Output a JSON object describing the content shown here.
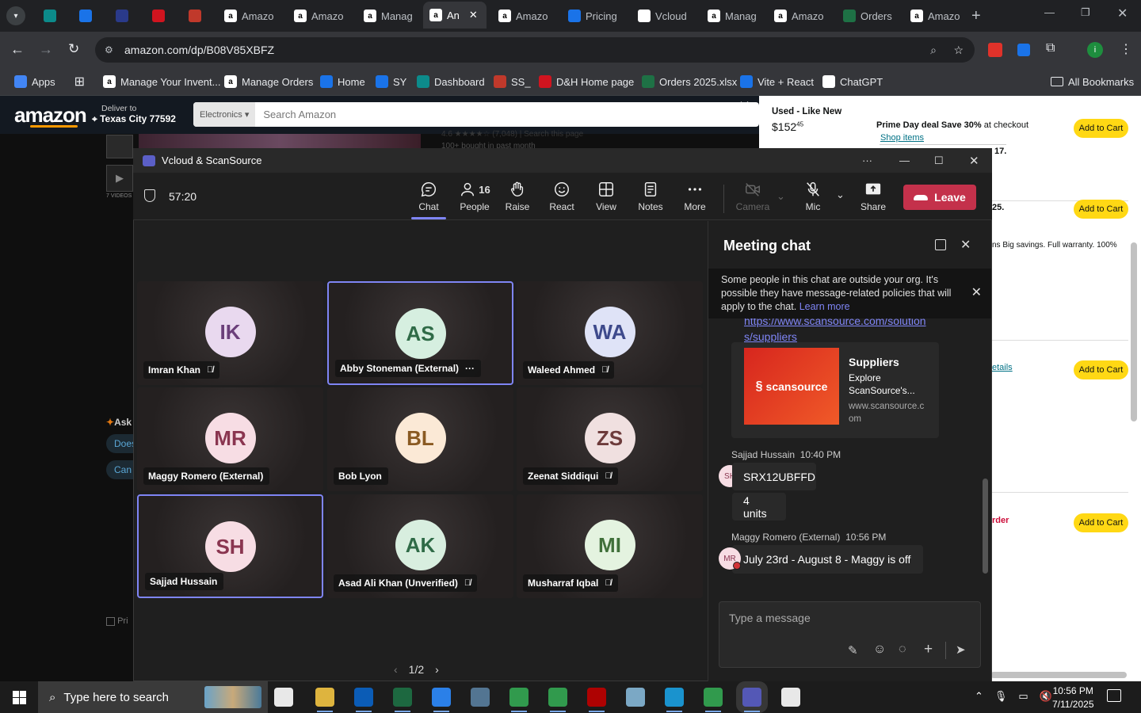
{
  "browser": {
    "tabs": [
      {
        "label": "",
        "icon": "edge-blue-icon"
      },
      {
        "label": "",
        "icon": "ec-icon"
      },
      {
        "label": "",
        "icon": "tl-icon"
      },
      {
        "label": "",
        "icon": "dh-icon"
      },
      {
        "label": "",
        "icon": "ss-icon"
      },
      {
        "label": "Amazo",
        "icon": "amazon-icon"
      },
      {
        "label": "Amazo",
        "icon": "amazon-icon"
      },
      {
        "label": "Manag",
        "icon": "amazon-icon"
      },
      {
        "label": "An",
        "icon": "amazon-icon"
      },
      {
        "label": "Amazo",
        "icon": "amazon-icon"
      },
      {
        "label": "Pricing",
        "icon": "dollar-icon"
      },
      {
        "label": "Vcloud",
        "icon": "chatgpt-icon"
      },
      {
        "label": "Manag",
        "icon": "amazon-icon"
      },
      {
        "label": "Amazo",
        "icon": "amazon-icon"
      },
      {
        "label": "Orders",
        "icon": "excel-icon"
      },
      {
        "label": "Amazo",
        "icon": "amazon-icon"
      }
    ],
    "url": "amazon.com/dp/B08V85XBFZ",
    "bookmarks": [
      "Apps",
      "Manage Your Invent...",
      "Manage Orders",
      "Home",
      "SY",
      "Dashboard",
      "SS_",
      "D&H Home page",
      "Orders 2025.xlsx",
      "Vite + React",
      "ChatGPT"
    ],
    "all_bookmarks": "All Bookmarks"
  },
  "amazon": {
    "deliver_to": "Deliver to",
    "location": "Texas City 77592",
    "search_category": "Electronics",
    "search_placeholder": "Search Amazon",
    "used_label": "Used - Like New",
    "used_price_dollars": "$152",
    "used_price_cents": "45",
    "prime_deal": "Prime Day deal Save 30%",
    "prime_deal_suffix": "at checkout",
    "shop_items": "Shop items",
    "num17": "17.",
    "num25": "25.",
    "warranty": "ns Big savings. Full warranty. 100%",
    "details": "etails",
    "order": "rder",
    "add_to_cart": "Add to Cart",
    "left_ask": "Ask",
    "left_does": "Does",
    "left_can": "Can",
    "left_pri": "Pri",
    "videos": "7 VIDEOS",
    "bought": "100+ bought in past month",
    "rating": "4.6 ★★★★☆ (7,048) | Search this page"
  },
  "teams": {
    "window_title": "Vcloud & ScanSource",
    "timer": "57:20",
    "buttons": {
      "chat": "Chat",
      "people": "People",
      "people_count": "16",
      "raise": "Raise",
      "react": "React",
      "view": "View",
      "notes": "Notes",
      "more": "More",
      "camera": "Camera",
      "mic": "Mic",
      "share": "Share",
      "leave": "Leave"
    },
    "participants": [
      {
        "initials": "IK",
        "name": "Imran Khan",
        "muted": true,
        "speaking": false,
        "bg": "#e9d9ef",
        "fg": "#6b3f7a"
      },
      {
        "initials": "AS",
        "name": "Abby Stoneman (External)",
        "muted": false,
        "speaking": true,
        "bg": "#d6efe0",
        "fg": "#2f6b47"
      },
      {
        "initials": "WA",
        "name": "Waleed Ahmed",
        "muted": true,
        "speaking": false,
        "bg": "#dfe3f7",
        "fg": "#3e4a8c"
      },
      {
        "initials": "MR",
        "name": "Maggy Romero (External)",
        "muted": false,
        "speaking": false,
        "bg": "#f7dde4",
        "fg": "#8a3550"
      },
      {
        "initials": "BL",
        "name": "Bob Lyon",
        "muted": false,
        "speaking": false,
        "bg": "#fbe9d6",
        "fg": "#8a5a22"
      },
      {
        "initials": "ZS",
        "name": "Zeenat Siddiqui",
        "muted": true,
        "speaking": false,
        "bg": "#f0e0e0",
        "fg": "#6d3b3b"
      },
      {
        "initials": "SH",
        "name": "Sajjad Hussain",
        "muted": false,
        "speaking": true,
        "bg": "#f7dde4",
        "fg": "#8a3550"
      },
      {
        "initials": "AK",
        "name": "Asad Ali Khan (Unverified)",
        "muted": true,
        "speaking": false,
        "bg": "#d8eedf",
        "fg": "#2f6b47"
      },
      {
        "initials": "MI",
        "name": "Musharraf Iqbal",
        "muted": true,
        "speaking": false,
        "bg": "#e4f3e0",
        "fg": "#40703a"
      }
    ],
    "pager": "1/2",
    "chat": {
      "title": "Meeting chat",
      "notice": "Some people in this chat are outside your org. It's possible they have message-related policies that will apply to the chat.",
      "learn_more": "Learn more",
      "link_line1": "https://www.scansource.com/solution",
      "link_line2": "s/suppliers",
      "card_title": "Suppliers",
      "card_desc": "Explore ScanSource's...",
      "card_domain": "www.scansource.com",
      "card_logo": "scansource",
      "msg1_author": "Sajjad Hussain",
      "msg1_time": "10:40 PM",
      "msg1_initials": "SH",
      "msg1_text": "SRX12UBFFD",
      "msg2_text": "4 units",
      "msg3_author": "Maggy Romero (External)",
      "msg3_time": "10:56 PM",
      "msg3_initials": "MR",
      "msg3_text": "July 23rd - August 8 - Maggy is off",
      "compose_placeholder": "Type a message"
    }
  },
  "taskbar": {
    "search_placeholder": "Type here to search",
    "time": "10:56 PM",
    "date": "7/11/2025"
  },
  "colors": {
    "accent": "#7f85f5",
    "leave": "#c4314b",
    "amazon_dark": "#131921",
    "cart": "#ffd814"
  }
}
